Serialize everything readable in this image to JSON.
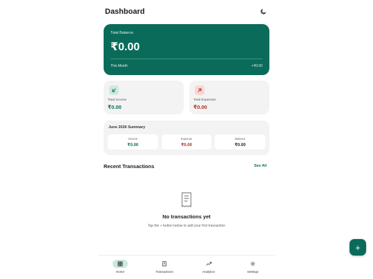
{
  "header": {
    "title": "Dashboard",
    "theme_icon": "moon-icon"
  },
  "balance": {
    "label": "Total Balance",
    "amount": "₹0.00",
    "month_label": "This Month",
    "month_value": "+₹0.00"
  },
  "income": {
    "icon": "arrow-down-left-icon",
    "label": "Total Income",
    "value": "₹0.00"
  },
  "expense": {
    "icon": "arrow-up-right-icon",
    "label": "Total Expenses",
    "value": "₹0.00"
  },
  "summary": {
    "title": "June 2026 Summary",
    "cells": [
      {
        "label": "Income",
        "value": "₹0.00"
      },
      {
        "label": "Expense",
        "value": "₹0.00"
      },
      {
        "label": "Balance",
        "value": "₹0.00"
      }
    ]
  },
  "recent": {
    "title": "Recent Transactions",
    "see_all": "See All"
  },
  "empty_state": {
    "icon": "receipt-icon",
    "title": "No transactions yet",
    "subtitle": "Tap the + button below to add your first transaction"
  },
  "fab": {
    "label": "+"
  },
  "nav": [
    {
      "label": "Home",
      "icon": "home-grid-icon",
      "active": true
    },
    {
      "label": "Transactions",
      "icon": "transactions-receipt-icon",
      "active": false
    },
    {
      "label": "Analytics",
      "icon": "analytics-chart-icon",
      "active": false
    },
    {
      "label": "Settings",
      "icon": "settings-gear-icon",
      "active": false
    }
  ],
  "colors": {
    "primary": "#0a6b5a",
    "income": "#0a6b5a",
    "expense": "#b3261e",
    "card_bg": "#f3f3f3"
  }
}
